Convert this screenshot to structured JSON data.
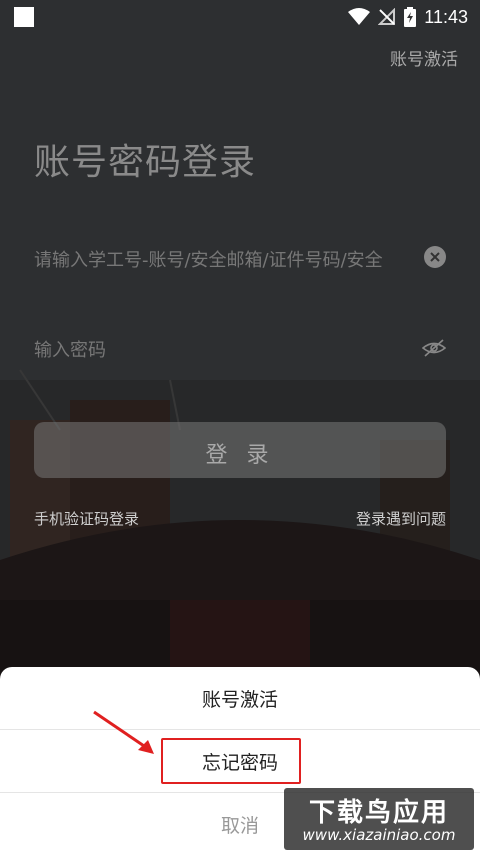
{
  "status_bar": {
    "time": "11:43"
  },
  "header": {
    "activate_link": "账号激活"
  },
  "login": {
    "title": "账号密码登录",
    "account_placeholder": "请输入学工号-账号/安全邮箱/证件号码/安全",
    "password_placeholder": "输入密码",
    "login_button": "登 录",
    "sms_login_link": "手机验证码登录",
    "help_link": "登录遇到问题"
  },
  "bottom_sheet": {
    "items": [
      {
        "label": "账号激活"
      },
      {
        "label": "忘记密码"
      },
      {
        "label": "取消"
      }
    ]
  },
  "watermark": {
    "brand": "下载鸟应用",
    "url": "www.xiazainiao.com"
  },
  "colors": {
    "highlight": "#e02020"
  }
}
